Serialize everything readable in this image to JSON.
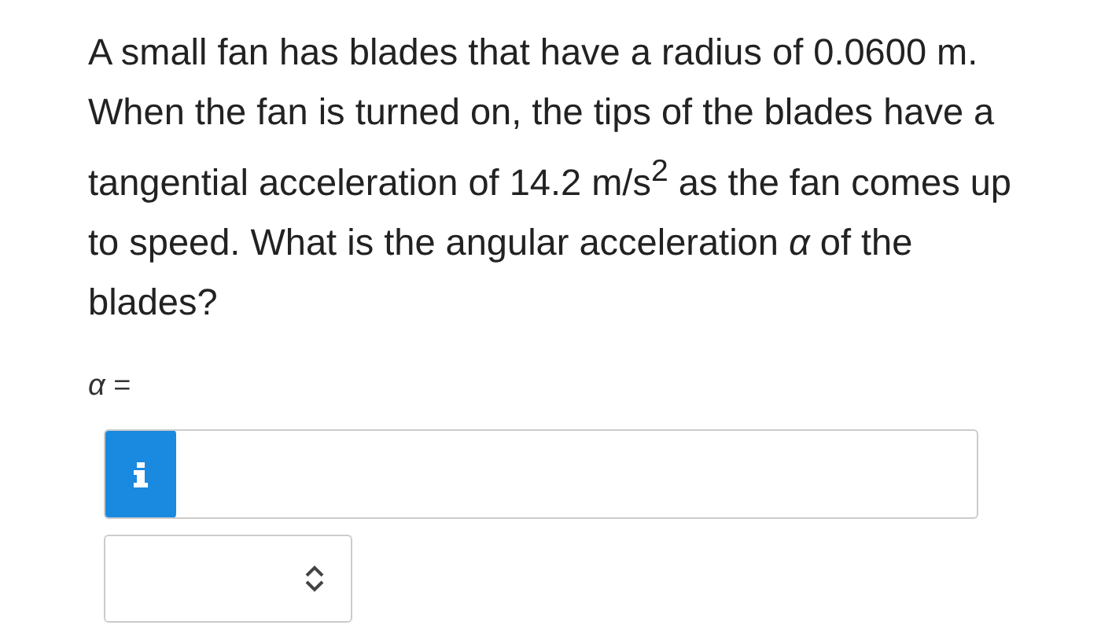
{
  "question": "A small fan has blades that have a radius of 0.0600 m. When the fan is turned on, the tips of the blades have a tangential acceleration of 14.2 m/s$^{2}$ as the fan comes up to speed. What is the angular acceleration *α* of the blades?",
  "answer_label": "*α* ="
}
